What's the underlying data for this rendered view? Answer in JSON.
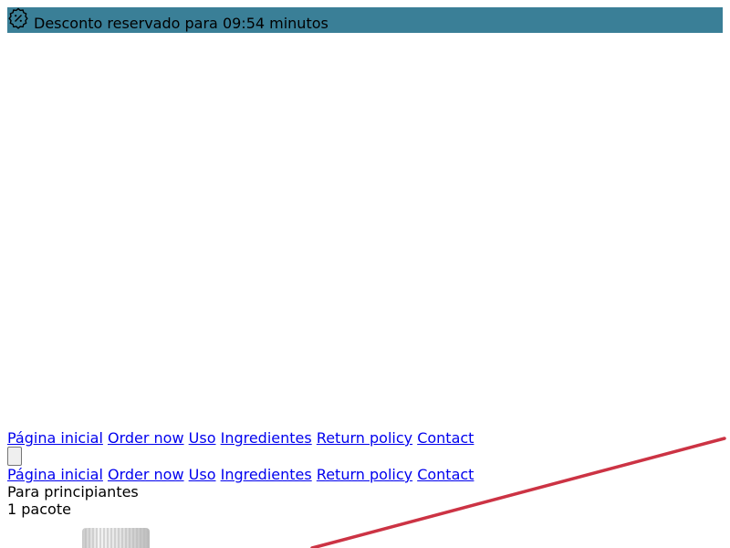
{
  "banner": {
    "text": "Desconto reservado para 09:54 minutos",
    "icon": "discount-badge-icon",
    "background": "#3a7f97"
  },
  "nav_primary": {
    "items": [
      {
        "label": "Página inicial"
      },
      {
        "label": "Order now"
      },
      {
        "label": "Uso"
      },
      {
        "label": "Ingredientes"
      },
      {
        "label": "Return policy"
      },
      {
        "label": "Contact"
      }
    ]
  },
  "nav_secondary": {
    "items": [
      {
        "label": "Página inicial"
      },
      {
        "label": "Order now"
      },
      {
        "label": "Uso"
      },
      {
        "label": "Ingredientes"
      },
      {
        "label": "Return policy"
      },
      {
        "label": "Contact"
      }
    ]
  },
  "menu_toggle": {
    "icon": "menu-toggle-button"
  },
  "offer": {
    "plan_label": "Para principiantes",
    "quantity": "1 pacote",
    "product_icon": "supplement-bottle-image"
  },
  "colors": {
    "link": "#0000ee",
    "accent_line": "#cc3344"
  }
}
